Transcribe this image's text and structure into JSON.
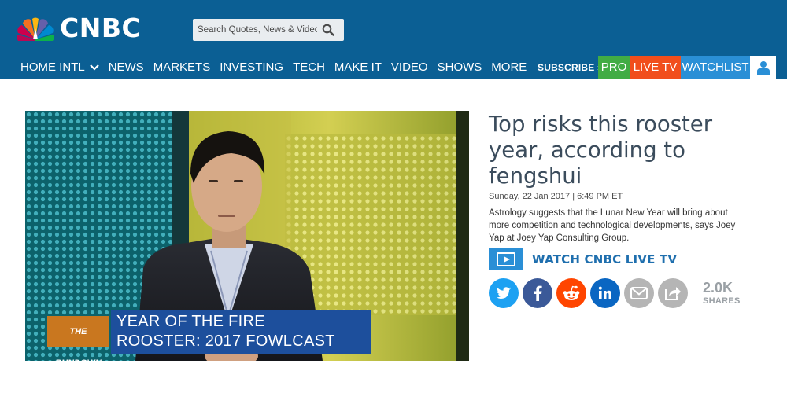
{
  "brand": {
    "logo_text": "CNBC",
    "header_color": "#0b5f94"
  },
  "search": {
    "placeholder": "Search Quotes, News & Video",
    "icon": "search-icon"
  },
  "nav": {
    "items": [
      "HOME INTL",
      "NEWS",
      "MARKETS",
      "INVESTING",
      "TECH",
      "MAKE IT",
      "VIDEO",
      "SHOWS",
      "MORE"
    ],
    "subscribe_label": "SUBSCRIBE ›",
    "pro_label": "PRO",
    "live_tv_label": "LIVE TV",
    "watchlist_label": "WATCHLIST",
    "colors": {
      "pro": "#41ac44",
      "live_tv": "#f14e1c",
      "watchlist": "#2a8fd6"
    }
  },
  "video": {
    "show_tag": "THE RUNDOWN",
    "caption_line1": "YEAR OF THE FIRE",
    "caption_line2": "ROOSTER: 2017 FOWLCAST"
  },
  "article": {
    "headline_line1": "Top risks this rooster",
    "headline_line2": "year, according to",
    "headline_line3": "fengshui",
    "dateline": "Sunday, 22 Jan 2017 | 6:49 PM ET",
    "summary_line1": "Astrology suggests that the Lunar New Year will bring about",
    "summary_line2": "more competition and technological developments, says Joey",
    "summary_line3": "Yap at Joey Yap Consulting Group.",
    "watch_live_label": "WATCH CNBC LIVE TV"
  },
  "share": {
    "buttons": [
      {
        "icon": "twitter-icon",
        "color": "#1da1f2"
      },
      {
        "icon": "facebook-icon",
        "color": "#3b5998"
      },
      {
        "icon": "reddit-icon",
        "color": "#ff4500"
      },
      {
        "icon": "linkedin-icon",
        "color": "#0a66c2"
      },
      {
        "icon": "email-icon",
        "color": "#b5b5b5"
      },
      {
        "icon": "share-icon",
        "color": "#b5b5b5"
      }
    ],
    "count": "2.0K",
    "count_label": "SHARES"
  }
}
